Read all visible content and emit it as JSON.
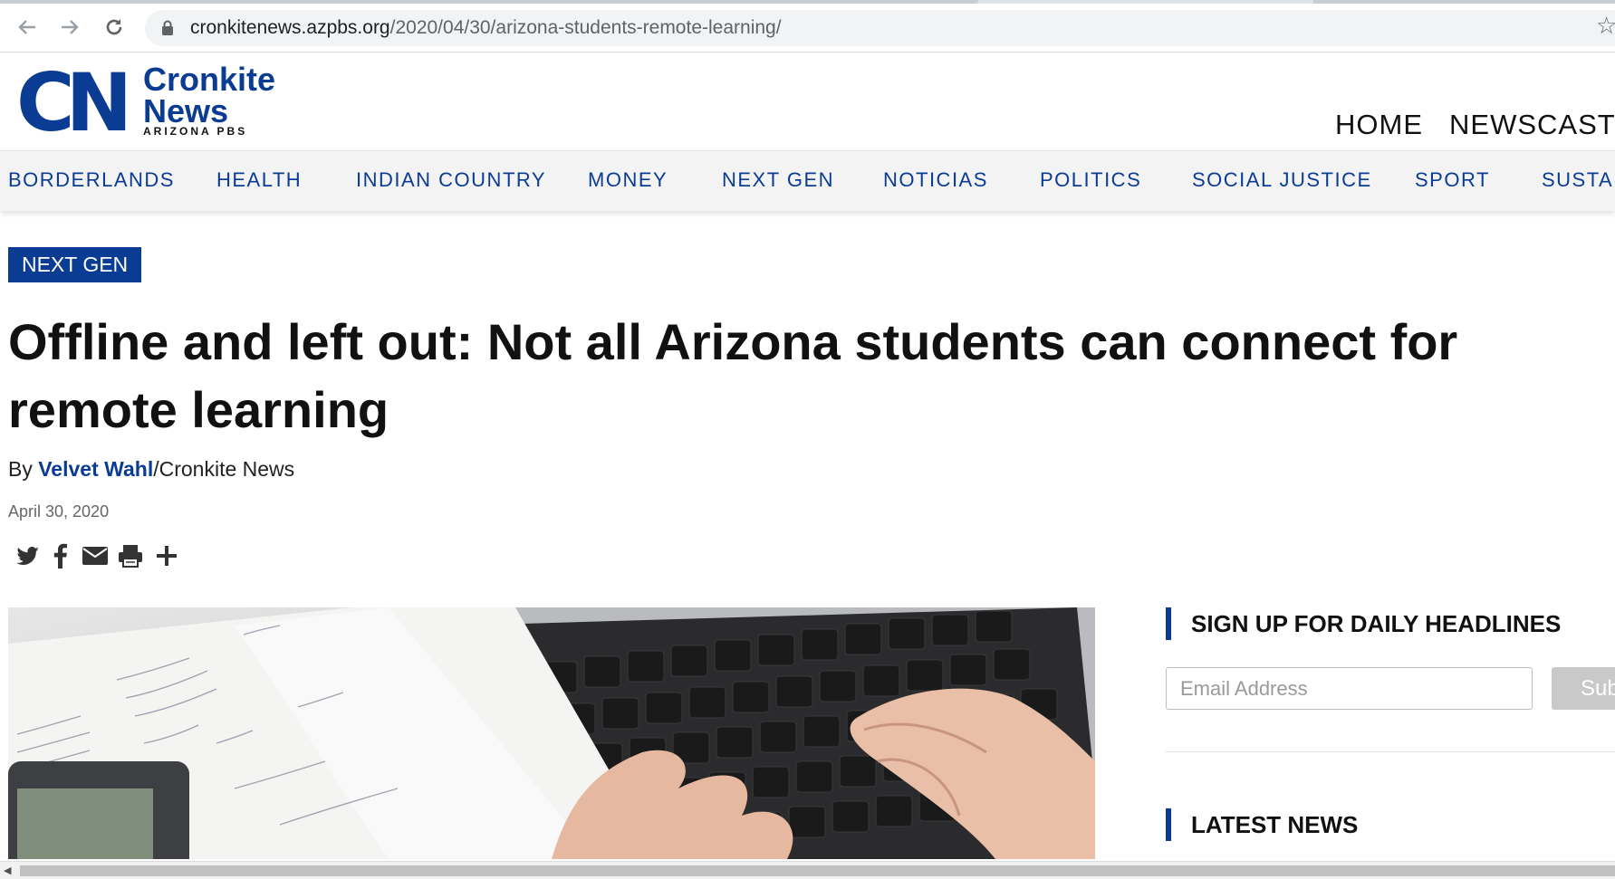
{
  "browser": {
    "back_icon": "arrow-left-icon",
    "forward_icon": "arrow-right-icon",
    "reload_icon": "reload-icon",
    "url_host": "cronkitenews.azpbs.org",
    "url_path": "/2020/04/30/arizona-students-remote-learning/",
    "bookmark_icon": "star-icon"
  },
  "site": {
    "logo_mark": "CN",
    "logo_line1": "Cronkite",
    "logo_line2": "News",
    "logo_sub": "ARIZONA PBS",
    "brand_color": "#0b3c94",
    "top_nav": [
      "HOME",
      "NEWSCAST"
    ]
  },
  "sections": [
    "BORDERLANDS",
    "HEALTH",
    "INDIAN COUNTRY",
    "MONEY",
    "NEXT GEN",
    "NOTICIAS",
    "POLITICS",
    "SOCIAL JUSTICE",
    "SPORT",
    "SUSTAI"
  ],
  "article": {
    "category": "NEXT GEN",
    "headline_line1": "Offline and left out: Not all Arizona students can connect for",
    "headline_line2": "remote learning",
    "by_prefix": "By ",
    "author": "Velvet Wahl",
    "outlet": "/Cronkite News",
    "date": "April 30, 2020",
    "share_icons": [
      "twitter-icon",
      "facebook-icon",
      "email-icon",
      "print-icon",
      "plus-icon"
    ],
    "hero_image": "hands-typing-on-laptop-with-notes-and-calculator"
  },
  "sidebar": {
    "signup_heading": "SIGN UP FOR DAILY HEADLINES",
    "email_placeholder": "Email Address",
    "subscribe_label": "Sub",
    "latest_heading": "LATEST NEWS"
  }
}
